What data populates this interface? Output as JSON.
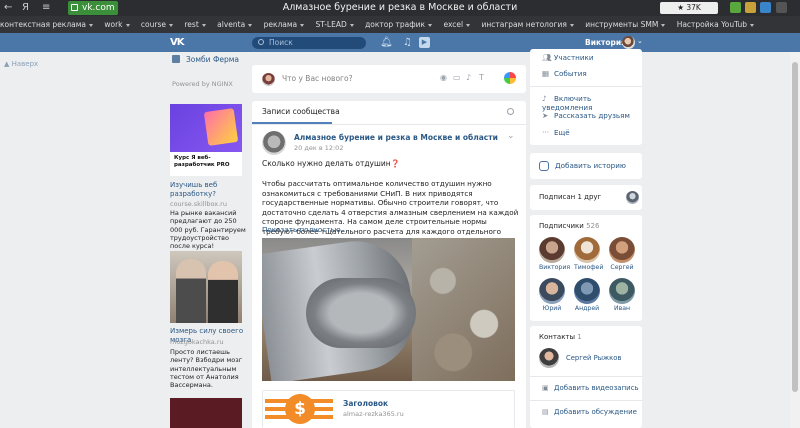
{
  "browser": {
    "url": "vk.com",
    "title": "Алмазное бурение и резка в Москве и области",
    "reviews": "37K отзывов",
    "nav": [
      "←",
      "Я",
      "≡"
    ],
    "bookmarks": [
      "контекстная реклама",
      "work",
      "course",
      "rest",
      "alventa",
      "реклама",
      "ST-LEAD",
      "доктор трафик",
      "excel",
      "инстаграм нетология",
      "инструменты SMM",
      "Настройка YouTub"
    ]
  },
  "header": {
    "logo": "VK",
    "search_placeholder": "Поиск",
    "username": "Виктория"
  },
  "left": {
    "hint": "Наверх",
    "menu_item": "Зомби Ферма",
    "powered": "Powered by NGINX",
    "ads": [
      {
        "title": "Изучишь веб разработку?",
        "domain": "course.skillbox.ru",
        "text": "На рынке вакансий предлагают до 250 000 руб. Гарантируем трудоустройство после курса!",
        "image_caption": "Курс Я веб-разработчик PRO"
      },
      {
        "title": "Измерь силу своего мозга",
        "domain": "mozgokachka.ru",
        "text": "Просто листаешь ленту? Взбодри мозг интеллектуальным тестом от Анатолия Вассермана."
      }
    ]
  },
  "composer": {
    "placeholder": "Что у Вас нового?"
  },
  "wall": {
    "tab": "Записи сообщества",
    "post": {
      "author": "Алмазное бурение и резка в Москве и области",
      "date": "20 дек в 12:02",
      "lead": "Сколько нужно делать отдушин❓",
      "body": "Чтобы рассчитать оптимальное количество отдушин нужно ознакомиться с требованиями СНиП. В них приводятся государственные нормативы. Обычно строители говорят, что достаточно сделать 4 отверстия алмазным сверлением на каждой стороне фундамента. На самом деле строительные нормы требуют более тщательного расчета для каждого отдельного объекта.",
      "more": "Показать полностью...",
      "link_title": "Заголовок",
      "link_domain": "almaz-rezka365.ru",
      "link_symbol": "$"
    }
  },
  "right": {
    "actions": [
      "Участники",
      "События",
      "Включить уведомления",
      "Рассказать друзьям",
      "Ещё"
    ],
    "story": "Добавить историю",
    "subscribed": "Подписан 1 друг",
    "followers_title": "Подписчики",
    "followers_count": "526",
    "followers": [
      {
        "name": "Виктория",
        "c1": "#c9a48c",
        "c2": "#5b3b2f"
      },
      {
        "name": "Тимофей",
        "c1": "#efe4d6",
        "c2": "#a06a3a"
      },
      {
        "name": "Сергей",
        "c1": "#d3a07e",
        "c2": "#7a4e36"
      },
      {
        "name": "Юрий",
        "c1": "#d9b59b",
        "c2": "#3b4a5c"
      },
      {
        "name": "Андрей",
        "c1": "#7f98b3",
        "c2": "#2f4e6e"
      },
      {
        "name": "Иван",
        "c1": "#9fb3a2",
        "c2": "#3d5a63"
      }
    ],
    "contacts_title": "Контакты",
    "contacts_count": "1",
    "contact_name": "Сергей Рыжков",
    "add_video": "Добавить видеозапись",
    "add_discussion": "Добавить обсуждение"
  }
}
